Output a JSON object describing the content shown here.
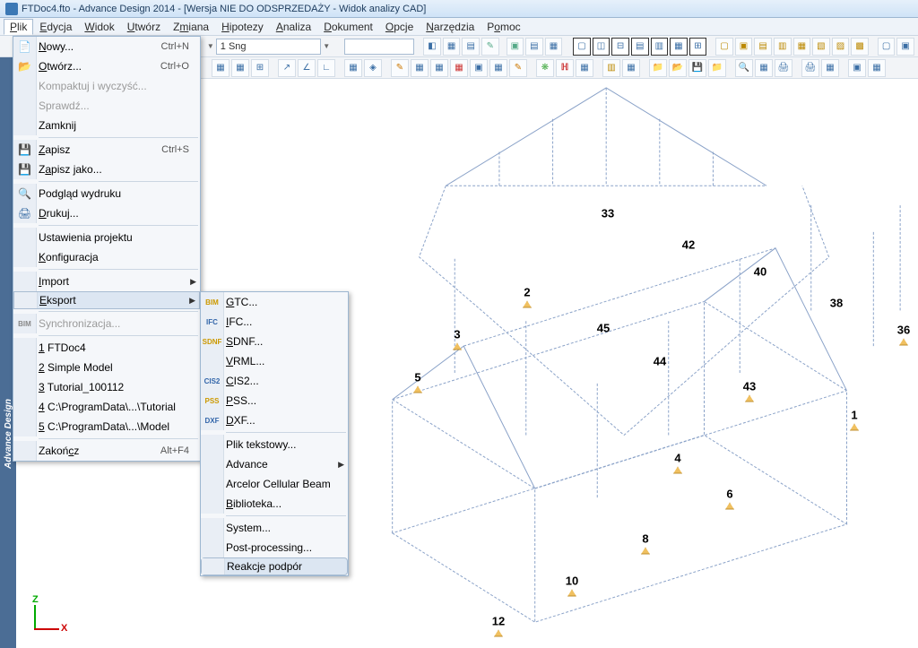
{
  "title": "FTDoc4.fto - Advance Design 2014 - [Wersja NIE DO ODSPRZEDAŻY - Widok analizy CAD]",
  "menubar": {
    "plik": "Plik",
    "edycja": "Edycja",
    "widok": "Widok",
    "utworz": "Utwórz",
    "zmiana": "Zmiana",
    "hipotezy": "Hipotezy",
    "analiza": "Analiza",
    "dokument": "Dokument",
    "opcje": "Opcje",
    "narzedzia": "Narzędzia",
    "pomoc": "Pomoc"
  },
  "toolbar": {
    "sng": "1 Sng"
  },
  "sidebar_label": "Advance Design",
  "file_menu": {
    "nowy": "Nowy...",
    "nowy_sc": "Ctrl+N",
    "otworz": "Otwórz...",
    "otworz_sc": "Ctrl+O",
    "kompaktuj": "Kompaktuj i wyczyść...",
    "sprawdz": "Sprawdź...",
    "zamknij": "Zamknij",
    "zapisz": "Zapisz",
    "zapisz_sc": "Ctrl+S",
    "zapisz_jako": "Zapisz jako...",
    "podglad": "Podgląd wydruku",
    "drukuj": "Drukuj...",
    "ustawienia": "Ustawienia projektu",
    "konfiguracja": "Konfiguracja",
    "import": "Import",
    "eksport": "Eksport",
    "synchronizacja": "Synchronizacja...",
    "recent1": "1 FTDoc4",
    "recent2": "2 Simple Model",
    "recent3": "3 Tutorial_100112",
    "recent4": "4 C:\\ProgramData\\...\\Tutorial",
    "recent5": "5 C:\\ProgramData\\...\\Model",
    "zakoncz": "Zakończ",
    "zakoncz_sc": "Alt+F4"
  },
  "export_menu": {
    "gtc": "GTC...",
    "ifc": "IFC...",
    "sdnf": "SDNF...",
    "vrml": "VRML...",
    "cis2": "CIS2...",
    "pss": "PSS...",
    "dxf": "DXF...",
    "plik_tekstowy": "Plik tekstowy...",
    "advance": "Advance",
    "arcelor": "Arcelor Cellular Beam",
    "biblioteka": "Biblioteka...",
    "system": "System...",
    "postprocessing": "Post-processing...",
    "reakcje": "Reakcje podpór"
  },
  "axis": {
    "z": "Z",
    "x": "X"
  },
  "nodes": {
    "n33": "33",
    "n42": "42",
    "n40": "40",
    "n38": "38",
    "n2": "2",
    "n45": "45",
    "n36": "36",
    "n3": "3",
    "n44": "44",
    "n5": "5",
    "n43": "43",
    "n1": "1",
    "n4": "4",
    "n6": "6",
    "n8": "8",
    "n10": "10",
    "n12": "12"
  }
}
